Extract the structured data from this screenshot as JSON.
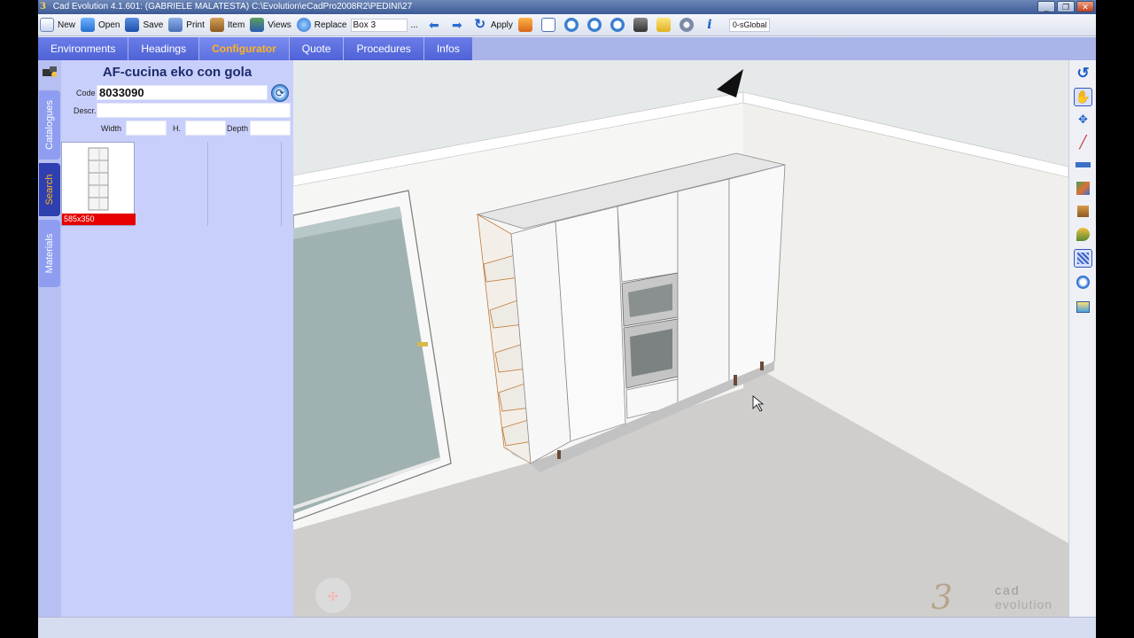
{
  "window": {
    "title": "Cad Evolution 4.1.601: (GABRIELE MALATESTA)  C:\\Evolution\\eCadPro2008R2\\PEDINI\\27",
    "logo_glyph": "3",
    "controls": {
      "minimize": "_",
      "maximize": "❐",
      "close": "✕"
    }
  },
  "toolbar": {
    "new_label": "New",
    "open_label": "Open",
    "save_label": "Save",
    "print_label": "Print",
    "item_label": "Item",
    "views_label": "Views",
    "replace_label": "Replace",
    "replace_value": "Box 3",
    "more_label": "...",
    "apply_label": "Apply",
    "layer_value": "0-sGlobal"
  },
  "tabs": [
    {
      "label": "Environments",
      "active": false
    },
    {
      "label": "Headings",
      "active": false
    },
    {
      "label": "Configurator",
      "active": true
    },
    {
      "label": "Quote",
      "active": false
    },
    {
      "label": "Procedures",
      "active": false
    },
    {
      "label": "Infos",
      "active": false
    }
  ],
  "side_tabs": {
    "catalogues": "Catalogues",
    "search": "Search",
    "materials": "Materials"
  },
  "panel": {
    "title": "AF-cucina eko con gola",
    "code_label": "Code",
    "code_value": "8033090",
    "descr_label": "Descr.",
    "descr_value": "",
    "width_label": "Width",
    "height_label": "H.",
    "depth_label": "Depth",
    "width_value": "",
    "height_value": "",
    "depth_value": "",
    "thumbnail_caption": "585x350"
  },
  "viewport": {
    "brand_name": "cad",
    "brand_tagline": "evolution",
    "brand_glyph": "3"
  },
  "colors": {
    "tab_active_text": "#ffb21f",
    "tab_bg": "#5a6ddf",
    "panel_bg": "#c9cffb",
    "thumb_badge": "#e60000"
  }
}
